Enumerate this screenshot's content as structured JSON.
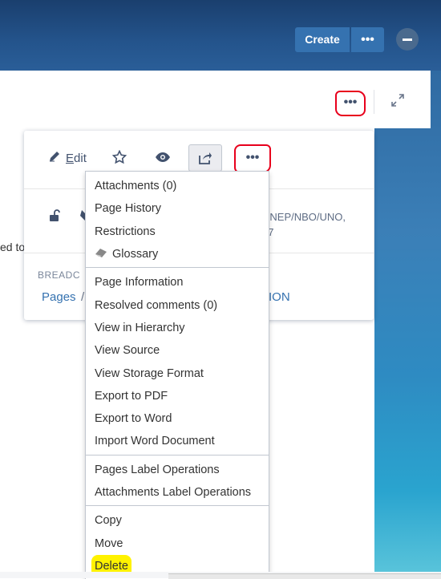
{
  "header": {
    "create_label": "Create",
    "more_label": "•••"
  },
  "page": {
    "more_label": "•••",
    "cut_text": "ed to"
  },
  "card": {
    "edit_label": "Edit",
    "more_label": "•••",
    "meta_line1": "UNEP/NBO/UNO,",
    "meta_line2": "17",
    "breadcrumbs_label": "BREADC",
    "bc_pages": "Pages",
    "bc_sep": "/",
    "bc_tail": "ION"
  },
  "menu": {
    "groups": [
      [
        "Attachments (0)",
        "Page History",
        "Restrictions",
        "Glossary"
      ],
      [
        "Page Information",
        "Resolved comments (0)",
        "View in Hierarchy",
        "View Source",
        "View Storage Format",
        "Export to PDF",
        "Export to Word",
        "Import Word Document"
      ],
      [
        "Pages Label Operations",
        "Attachments Label Operations"
      ],
      [
        "Copy",
        "Move",
        "Delete"
      ]
    ]
  },
  "colors": {
    "accent": "#3572b0",
    "annotation": "#e8001c",
    "highlight": "#fff200"
  }
}
